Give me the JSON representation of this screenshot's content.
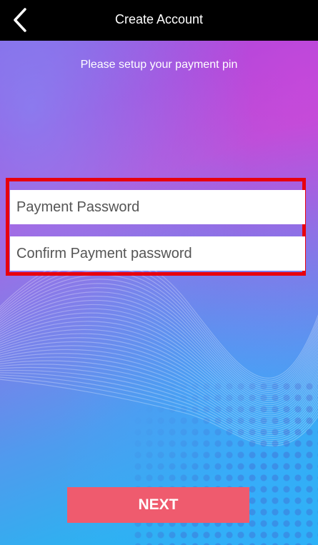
{
  "header": {
    "title": "Create Account",
    "back_icon": "chevron-left-icon"
  },
  "subtitle": "Please setup your payment pin",
  "form": {
    "payment_password_placeholder": "Payment Password",
    "confirm_password_placeholder": "Confirm Payment password"
  },
  "actions": {
    "next_label": "NEXT"
  },
  "colors": {
    "top_bar": "#000000",
    "button": "#ef5b6e",
    "highlight_border": "#e8000d"
  }
}
